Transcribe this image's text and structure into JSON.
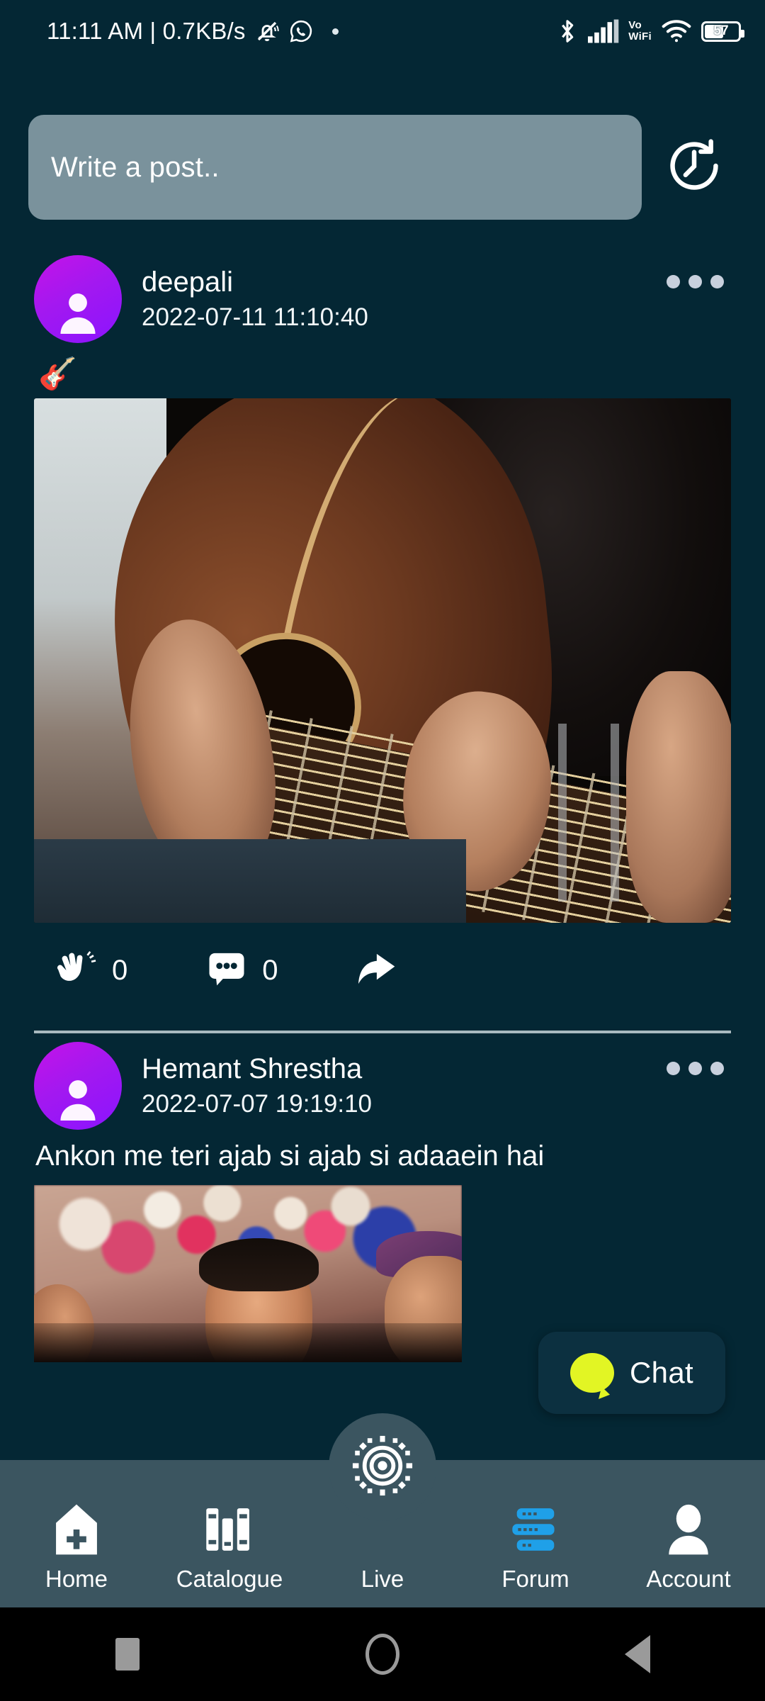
{
  "status_bar": {
    "clock": "11:11 AM | 0.7KB/s",
    "icons": [
      "mute-bell-icon",
      "whatsapp-icon",
      "dot-indicator",
      "bluetooth-icon",
      "signal-bars-icon",
      "wifi-icon"
    ],
    "network_label_line1": "Vo",
    "network_label_line2": "WiFi",
    "battery_percent": "57"
  },
  "composer": {
    "placeholder": "Write a post..",
    "value": "",
    "history_icon": "clock-history-icon"
  },
  "posts": [
    {
      "author": "deepali",
      "timestamp": "2022-07-11 11:10:40",
      "body": "🎸",
      "media_type": "image",
      "media_alt": "person playing acoustic guitar",
      "clap_count": "0",
      "comment_count": "0",
      "share_icon": "reply-arrow-icon",
      "menu_icon": "three-dots-menu-icon"
    },
    {
      "author": "Hemant Shrestha",
      "timestamp": "2022-07-07 19:19:10",
      "body": "Ankon me teri ajab si ajab si adaaein hai",
      "media_type": "gif",
      "media_alt": "bollywood scene with man in a crowd",
      "menu_icon": "three-dots-menu-icon"
    }
  ],
  "chat_fab": {
    "label": "Chat",
    "icon": "chat-bubble-icon",
    "bubble_color": "#e2f524"
  },
  "bottom_nav": {
    "active": "Forum",
    "items": [
      {
        "label": "Home",
        "icon": "home-plus-icon"
      },
      {
        "label": "Catalogue",
        "icon": "books-icon"
      },
      {
        "label": "Live",
        "icon": "broadcast-sun-icon"
      },
      {
        "label": "Forum",
        "icon": "forum-stack-icon"
      },
      {
        "label": "Account",
        "icon": "person-icon"
      }
    ]
  },
  "system_nav": {
    "recents": "recents-square-icon",
    "home": "home-circle-icon",
    "back": "back-triangle-icon"
  },
  "colors": {
    "background": "#042734",
    "composer_field": "#7a929c",
    "nav_bar": "#3b5560",
    "accent_avatar_start": "#c413e8",
    "accent_avatar_end": "#8a14ff",
    "forum_active": "#1fa0e8",
    "chat_bubble": "#e2f524"
  }
}
